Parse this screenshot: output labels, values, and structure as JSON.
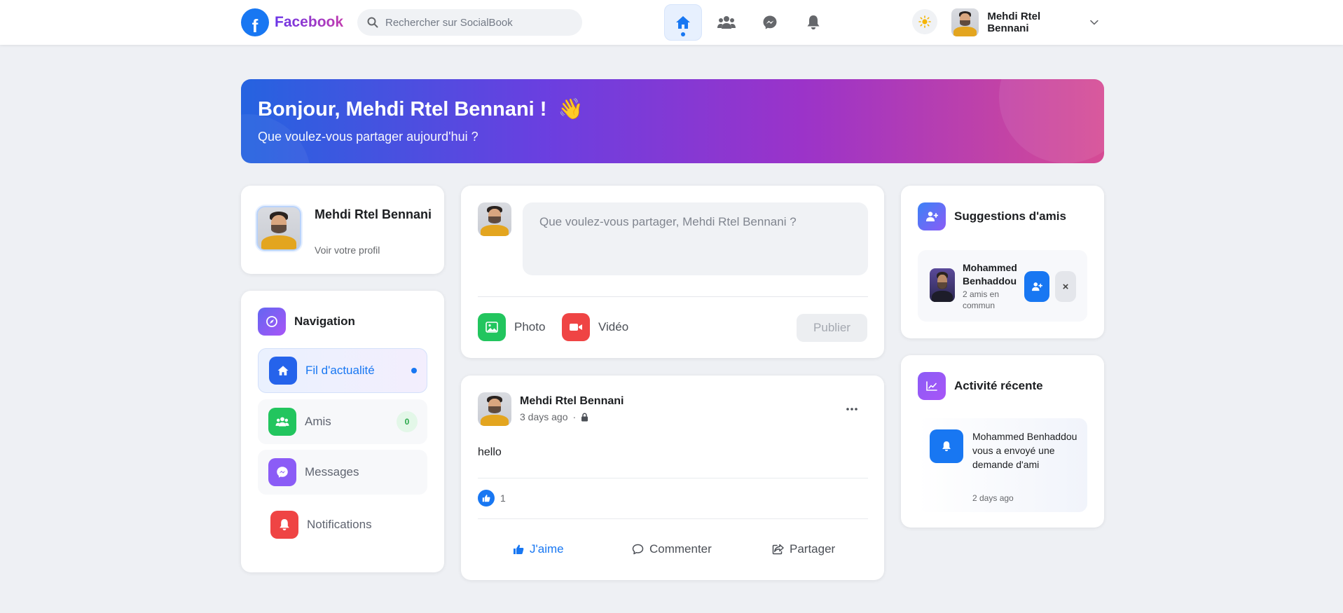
{
  "topbar": {
    "brand_logo": "f",
    "brand_name": "Facebook",
    "search_placeholder": "Rechercher sur SocialBook",
    "nav_icons": [
      "home-icon",
      "friends-icon",
      "messenger-icon",
      "bell-icon"
    ],
    "theme_icon": "sun-icon",
    "user_name": "Mehdi Rtel Bennani"
  },
  "hero": {
    "title": "Bonjour, Mehdi Rtel Bennani !",
    "emoji": "👋",
    "subtitle": "Que voulez-vous partager aujourd'hui ?"
  },
  "profile": {
    "name": "Mehdi Rtel Bennani",
    "link": "Voir votre profil"
  },
  "navigation": {
    "title": "Navigation",
    "items": [
      {
        "label": "Fil d'actualité",
        "icon": "home-icon",
        "color": "#2563eb",
        "active": true
      },
      {
        "label": "Amis",
        "icon": "friends-icon",
        "color": "#22c55e",
        "badge": "0"
      },
      {
        "label": "Messages",
        "icon": "messenger-icon",
        "color": "#8b5cf6"
      },
      {
        "label": "Notifications",
        "icon": "bell-icon",
        "color": "#ef4444"
      }
    ]
  },
  "composer": {
    "placeholder": "Que voulez-vous partager, Mehdi Rtel Bennani ?",
    "photo_label": "Photo",
    "video_label": "Vidéo",
    "publish_label": "Publier"
  },
  "post": {
    "author": "Mehdi Rtel Bennani",
    "time": "3 days ago",
    "privacy_icon": "lock-icon",
    "content": "hello",
    "likes_count": "1",
    "like_label": "J'aime",
    "comment_label": "Commenter",
    "share_label": "Partager"
  },
  "suggestions": {
    "title": "Suggestions d'amis",
    "items": [
      {
        "name": "Mohammed Benhaddou",
        "mutual": "2 amis en commun"
      }
    ],
    "close_label": "×"
  },
  "activity": {
    "title": "Activité récente",
    "items": [
      {
        "text": "Mohammed Benhaddou vous a envoyé une demande d'ami",
        "time": "2 days ago"
      }
    ]
  },
  "colors": {
    "primary": "#1877f2",
    "hero_gradient": [
      "#2563e0",
      "#6a3fe0",
      "#9b33c9",
      "#d64b94"
    ]
  }
}
